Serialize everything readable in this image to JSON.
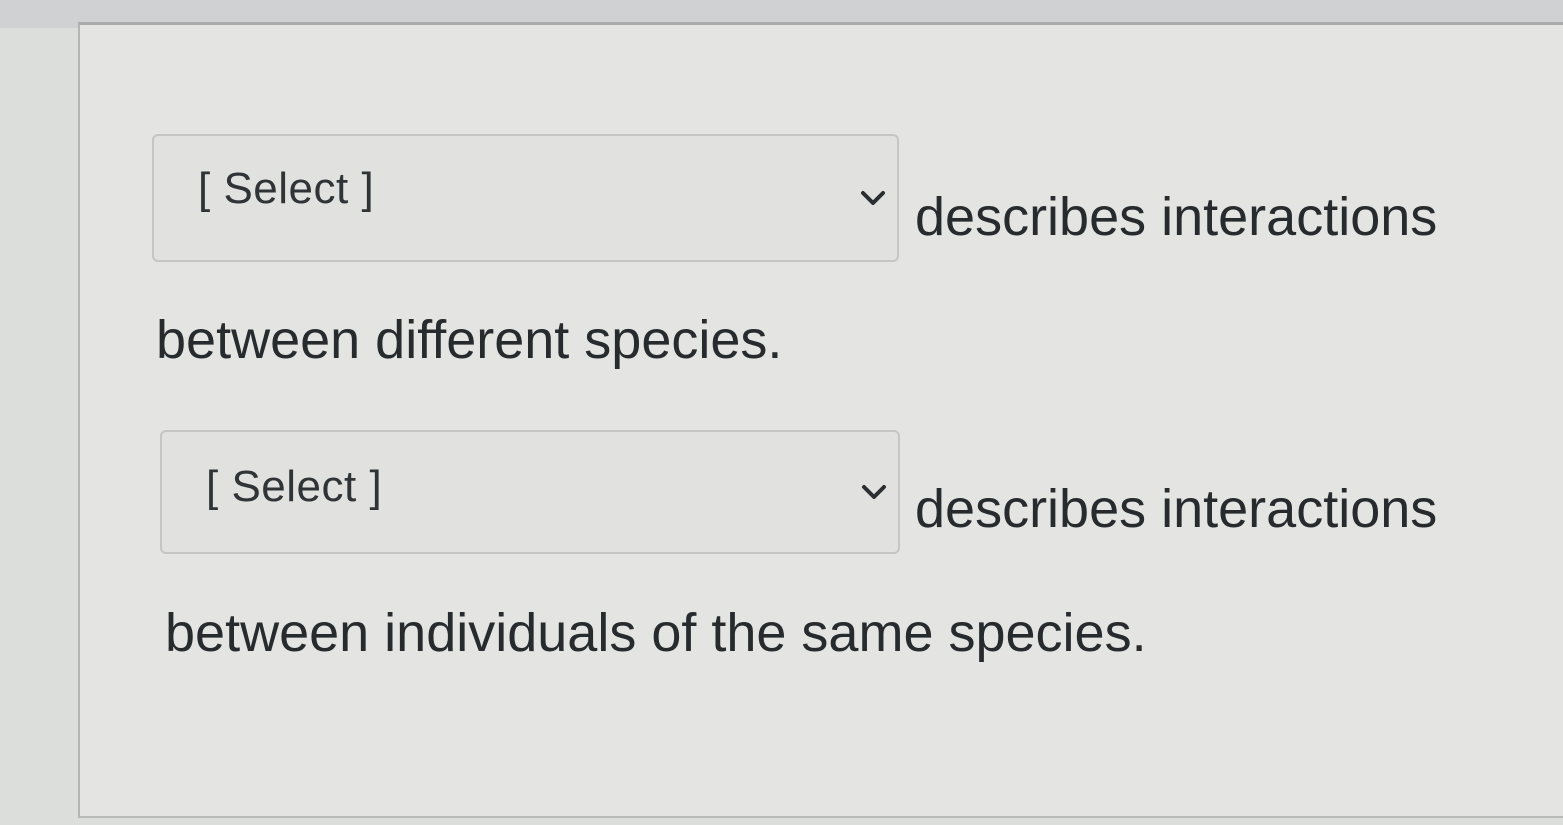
{
  "questions": [
    {
      "select": {
        "selected": "[ Select ]",
        "icon": "chevron-down-icon"
      },
      "after_text": "describes interactions",
      "continuation": "between different species."
    },
    {
      "select": {
        "selected": "[ Select ]",
        "icon": "chevron-down-icon"
      },
      "after_text": "describes interactions",
      "continuation": "between individuals of the same species."
    }
  ],
  "colors": {
    "background": "#dcdedc",
    "panel": "#e4e5e2",
    "select_border": "#c4c6c6",
    "text": "#272b2e"
  }
}
